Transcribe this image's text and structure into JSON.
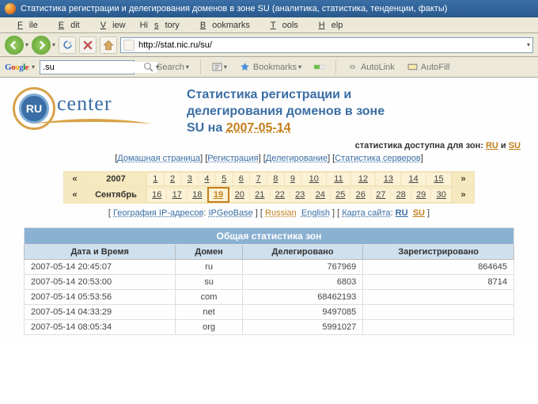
{
  "window": {
    "title": "Статистика регистрации и делегирования доменов в зоне SU (аналитика, статистика, тенденции, факты)"
  },
  "menu": {
    "file": "File",
    "edit": "Edit",
    "view": "View",
    "history": "History",
    "bookmarks": "Bookmarks",
    "tools": "Tools",
    "help": "Help"
  },
  "url": "http://stat.nic.ru/su/",
  "google": {
    "search_value": ".su",
    "search_btn": "Search",
    "bookmarks": "Bookmarks",
    "autolink": "AutoLink",
    "autofill": "AutoFill"
  },
  "logo": {
    "ru": "RU",
    "center": "center"
  },
  "headline": {
    "line1": "Статистика регистрации и",
    "line2": "делегирования доменов в зоне",
    "line3": "SU на ",
    "date": "2007-05-14"
  },
  "subhead": {
    "text": "статистика доступна для зон: ",
    "ru": "RU",
    "and": " и ",
    "su": "SU"
  },
  "nav": {
    "home": "Домашная страница",
    "reg": "Регистрация",
    "deleg": "Делегирование",
    "srv": "Статистика серверов"
  },
  "calendar": {
    "year": "2007",
    "month": "Сентябрь",
    "days1": [
      "1",
      "2",
      "3",
      "4",
      "5",
      "6",
      "7",
      "8",
      "9",
      "10",
      "11",
      "12",
      "13",
      "14",
      "15"
    ],
    "days2": [
      "16",
      "17",
      "18",
      "19",
      "20",
      "21",
      "22",
      "23",
      "24",
      "25",
      "26",
      "27",
      "28",
      "29",
      "30"
    ],
    "today": "19"
  },
  "linksline": {
    "geo": "География IP-адресов",
    "ipgeo": "IPGeoBase",
    "russian": "Russian",
    "english": "English",
    "sitemap": "Карта сайта",
    "ru": "RU",
    "su": "SU"
  },
  "stats": {
    "caption": "Общая статистика зон",
    "headers": {
      "dt": "Дата и Время",
      "domain": "Домен",
      "deleg": "Делегировано",
      "reg": "Зарегистрировано"
    },
    "rows": [
      {
        "dt": "2007-05-14 20:45:07",
        "domain": "ru",
        "deleg": "767969",
        "reg": "864645"
      },
      {
        "dt": "2007-05-14 20:53:00",
        "domain": "su",
        "deleg": "6803",
        "reg": "8714"
      },
      {
        "dt": "2007-05-14 05:53:56",
        "domain": "com",
        "deleg": "68462193",
        "reg": ""
      },
      {
        "dt": "2007-05-14 04:33:29",
        "domain": "net",
        "deleg": "9497085",
        "reg": ""
      },
      {
        "dt": "2007-05-14 08:05:34",
        "domain": "org",
        "deleg": "5991027",
        "reg": ""
      }
    ]
  }
}
